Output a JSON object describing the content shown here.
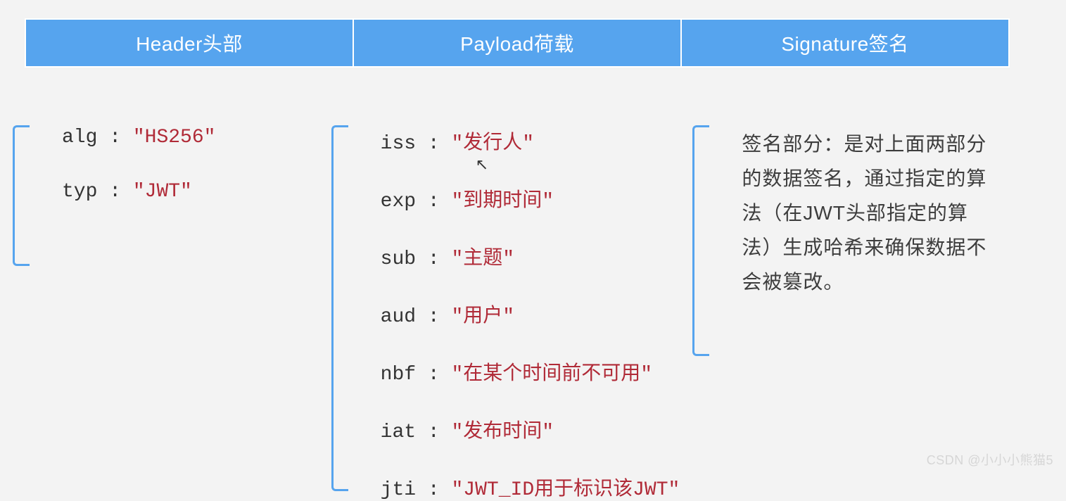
{
  "columns": {
    "header": {
      "title": "Header头部"
    },
    "payload": {
      "title": "Payload荷载"
    },
    "signature": {
      "title": "Signature签名"
    }
  },
  "header_claims": [
    {
      "key": "alg",
      "value": "\"HS256\""
    },
    {
      "key": "typ",
      "value": "\"JWT\""
    }
  ],
  "payload_claims": [
    {
      "key": "iss",
      "value": "\"发行人\""
    },
    {
      "key": "exp",
      "value": "\"到期时间\""
    },
    {
      "key": "sub",
      "value": "\"主题\""
    },
    {
      "key": "aud",
      "value": "\"用户\""
    },
    {
      "key": "nbf",
      "value": "\"在某个时间前不可用\""
    },
    {
      "key": "iat",
      "value": "\"发布时间\""
    },
    {
      "key": "jti",
      "value": "\"JWT_ID用于标识该JWT\""
    }
  ],
  "signature_desc": "签名部分：是对上面两部分的数据签名，通过指定的算法（在JWT头部指定的算法）生成哈希来确保数据不会被篡改。",
  "watermark": "CSDN @小小小熊猫5",
  "colors": {
    "header_bg": "#56a4ee",
    "header_fg": "#ffffff",
    "bracket": "#56a4ee",
    "value": "#b02a37",
    "key": "#333333"
  }
}
